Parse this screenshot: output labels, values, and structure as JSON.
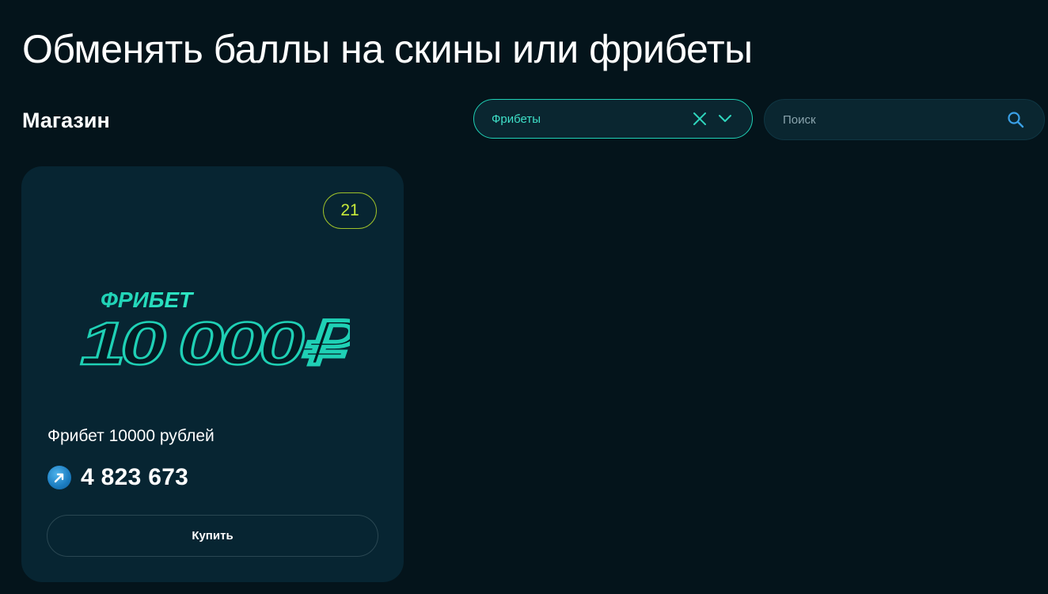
{
  "page": {
    "title": "Обменять баллы на скины или фрибеты"
  },
  "shop": {
    "section_title": "Магазин",
    "filter": {
      "selected_value": "Фрибеты",
      "clear_icon": "close-icon",
      "dropdown_icon": "chevron-down-icon"
    },
    "search": {
      "placeholder": "Поиск",
      "value": "",
      "icon": "search-icon"
    }
  },
  "products": [
    {
      "stock_count": "21",
      "image": {
        "label_top": "ФРИБЕТ",
        "label_main": "10 000₽"
      },
      "name": "Фрибет 10000 рублей",
      "price": "4 823 673",
      "currency_icon": "arrow-coin-icon",
      "buy_label": "Купить"
    }
  ],
  "colors": {
    "background": "#04141b",
    "card": "#072532",
    "accent_teal": "#1fd0b5",
    "badge_lime": "#c8ea3a",
    "search_icon": "#3aa0e6"
  }
}
